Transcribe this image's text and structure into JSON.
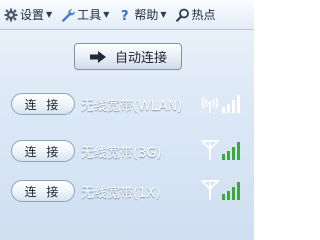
{
  "menubar": {
    "items": [
      {
        "label": "设置",
        "icon": "gear-icon"
      },
      {
        "label": "工具",
        "icon": "wrench-icon"
      },
      {
        "label": "帮助",
        "icon": "help-icon"
      },
      {
        "label": "热点",
        "icon": "search-icon"
      }
    ]
  },
  "main": {
    "auto_connect_label": "自动连接"
  },
  "connections": [
    {
      "button_label": "连 接",
      "name": "无线宽带(WLAN)",
      "signal_icon": "wifi-signal-icon",
      "signal_bars": 4,
      "signal_color": "#ffffff"
    },
    {
      "button_label": "连 接",
      "name": "无线宽带(3G)",
      "signal_icon": "antenna-signal-icon",
      "signal_bars": 4,
      "signal_color": "#3ca83a"
    },
    {
      "button_label": "连 接",
      "name": "无线宽带(1X)",
      "signal_icon": "antenna-signal-icon",
      "signal_bars": 4,
      "signal_color": "#3ca83a"
    }
  ],
  "colors": {
    "accent_blue": "#cfdff1",
    "signal_green": "#3ca83a"
  }
}
